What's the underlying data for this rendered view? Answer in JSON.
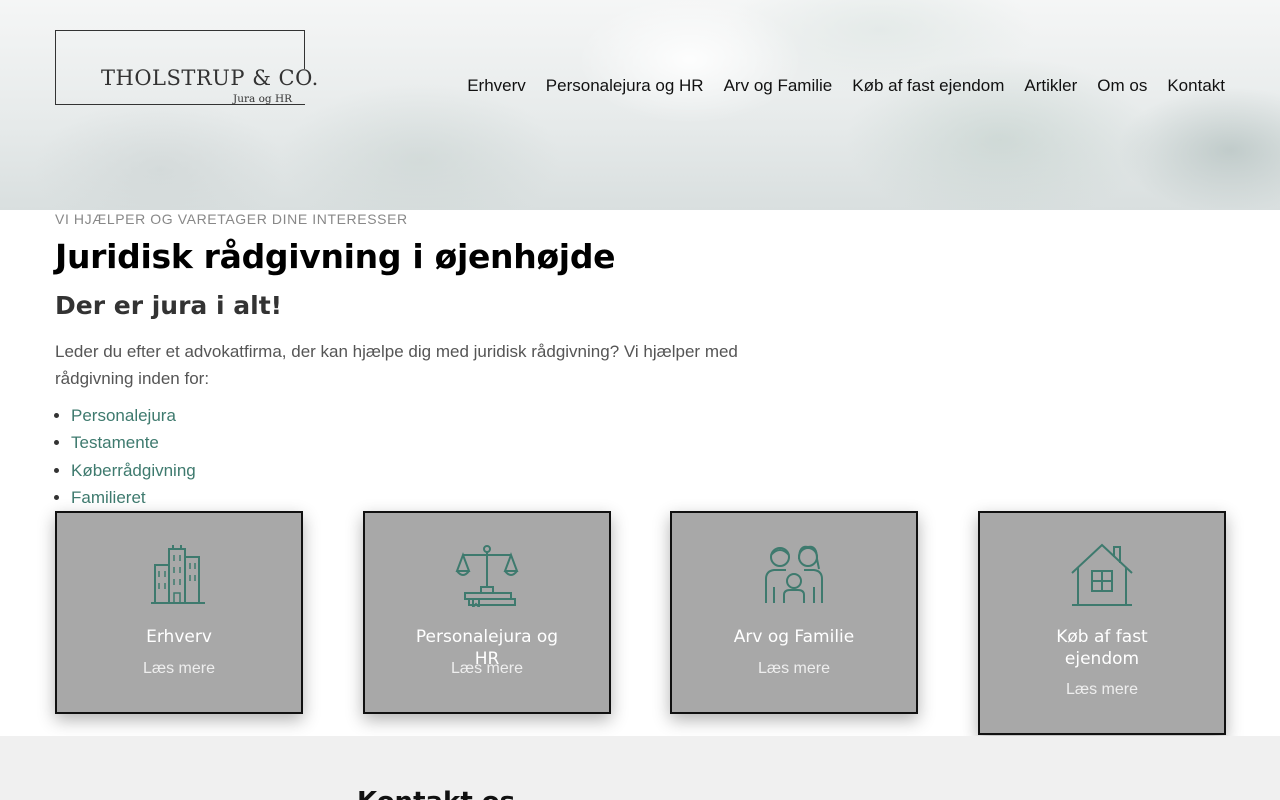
{
  "header": {
    "logo": {
      "name": "THOLSTRUP & CO.",
      "sub": "Jura og HR"
    },
    "nav": [
      "Erhverv",
      "Personalejura og HR",
      "Arv og Familie",
      "Køb af fast ejendom",
      "Artikler",
      "Om os",
      "Kontakt"
    ]
  },
  "main": {
    "eyebrow": "VI HJÆLPER OG VARETAGER DINE INTERESSER",
    "title": "Juridisk rådgivning i øjenhøjde",
    "subtitle": "Der er jura i alt!",
    "intro": "Leder du efter et advokatfirma, der kan hjælpe dig med juridisk rådgivning? Vi hjælper med rådgivning inden for:",
    "services": [
      "Personalejura",
      "Testamente",
      "Køberrådgivning",
      "Familieret"
    ]
  },
  "cards": [
    {
      "title": "Erhverv",
      "link": "Læs mere",
      "icon": "buildings-icon"
    },
    {
      "title": "Personalejura og HR",
      "link": "Læs mere",
      "icon": "scales-icon"
    },
    {
      "title": "Arv og Familie",
      "link": "Læs mere",
      "icon": "family-icon"
    },
    {
      "title": "Køb af fast ejendom",
      "link": "Læs mere",
      "icon": "house-icon"
    }
  ],
  "band": {
    "title": "Kontakt os ... "
  },
  "colors": {
    "accent": "#3e7a6e",
    "card_bg": "#a8a8a8",
    "icon": "#3e7a6e",
    "band_bg": "#f0f0f0"
  }
}
